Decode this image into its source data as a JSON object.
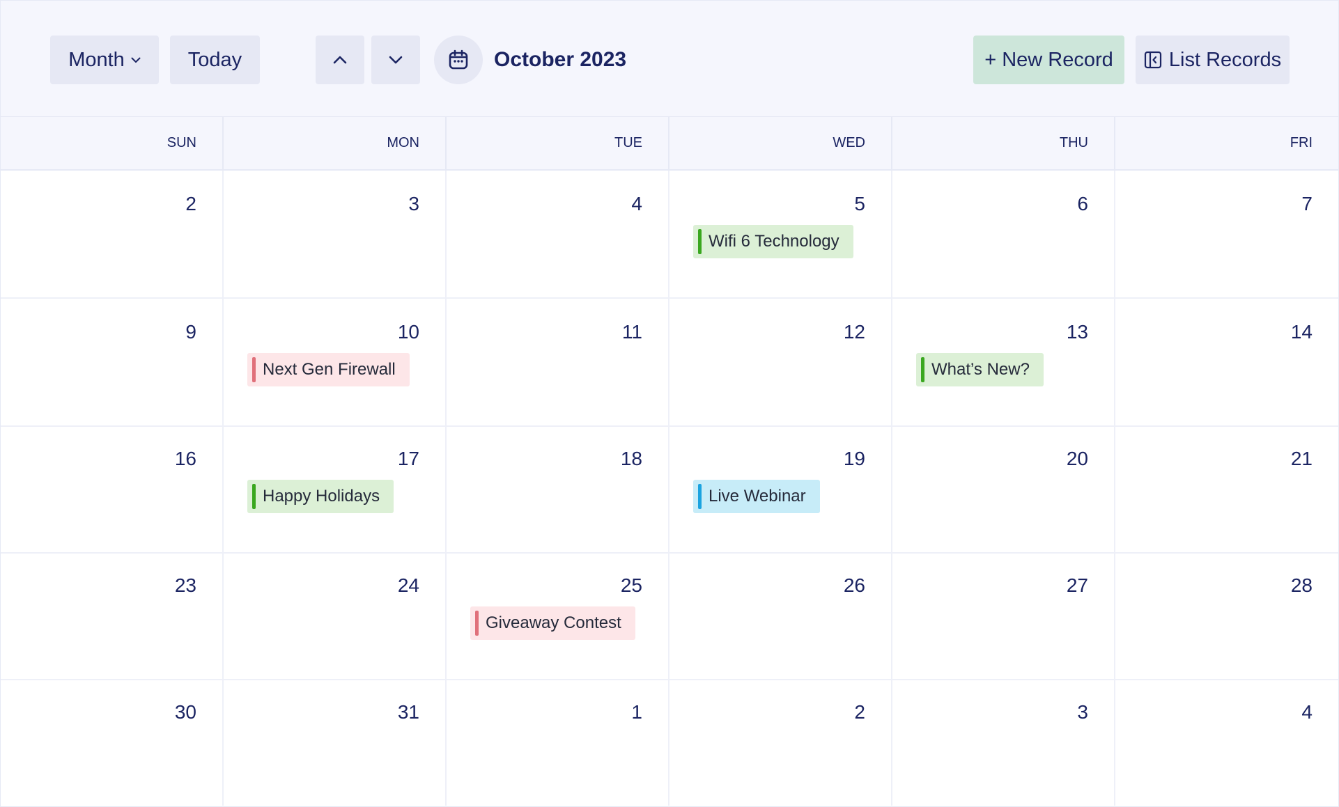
{
  "toolbar": {
    "view_label": "Month",
    "today_label": "Today",
    "month_title": "October 2023",
    "new_record_label": "+ New Record",
    "list_records_label": "List Records"
  },
  "weekdays": [
    "SUN",
    "MON",
    "TUE",
    "WED",
    "THU",
    "FRI"
  ],
  "weeks": [
    [
      "2",
      "3",
      "4",
      "5",
      "6",
      "7"
    ],
    [
      "9",
      "10",
      "11",
      "12",
      "13",
      "14"
    ],
    [
      "16",
      "17",
      "18",
      "19",
      "20",
      "21"
    ],
    [
      "23",
      "24",
      "25",
      "26",
      "27",
      "28"
    ],
    [
      "30",
      "31",
      "1",
      "2",
      "3",
      "4"
    ]
  ],
  "events": [
    {
      "label": "Wifi 6 Technology",
      "bg": "#dcf0d6",
      "bar": "#3aa71f"
    },
    {
      "label": "Next Gen Firewall",
      "bg": "#fde6e8",
      "bar": "#e0707a"
    },
    {
      "label": "What’s New?",
      "bg": "#dcf0d6",
      "bar": "#3aa71f"
    },
    {
      "label": "Happy Holidays",
      "bg": "#dcf0d6",
      "bar": "#3aa71f"
    },
    {
      "label": "Live Webinar",
      "bg": "#c7ecf8",
      "bar": "#1aa3e0"
    },
    {
      "label": "Giveaway Contest",
      "bg": "#fde6e8",
      "bar": "#e0707a"
    }
  ],
  "colors": {
    "toolbar_bg": "#f5f6fd",
    "button_bg": "#e6e8f4",
    "new_record_bg": "#cde6da",
    "text": "#1b2462"
  }
}
